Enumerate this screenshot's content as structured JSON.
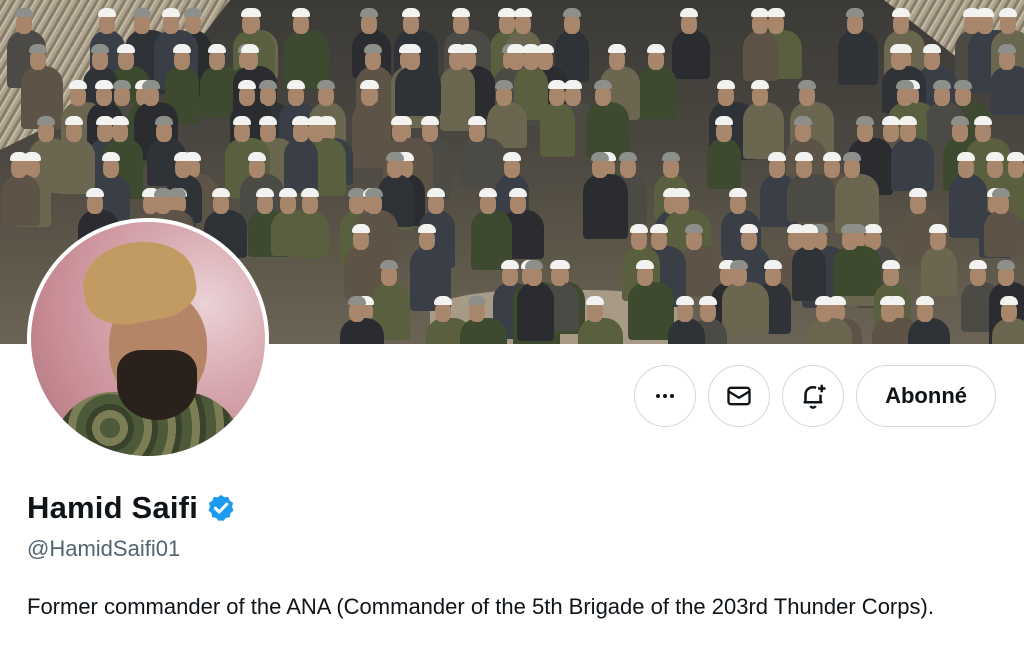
{
  "profile": {
    "display_name": "Hamid Saifi",
    "handle": "@HamidSaifi01",
    "verified": true,
    "bio": "Former commander of the ANA (Commander of the 5th Brigade of the 203rd Thunder Corps)."
  },
  "actions": {
    "more_icon": "more-horizontal-icon",
    "message_icon": "envelope-icon",
    "notify_icon": "bell-plus-icon",
    "follow_label": "Abonné"
  },
  "colors": {
    "verified_badge": "#1d9bf0",
    "text_primary": "#0f1419",
    "text_secondary": "#536471",
    "button_border": "#cfd9de"
  }
}
